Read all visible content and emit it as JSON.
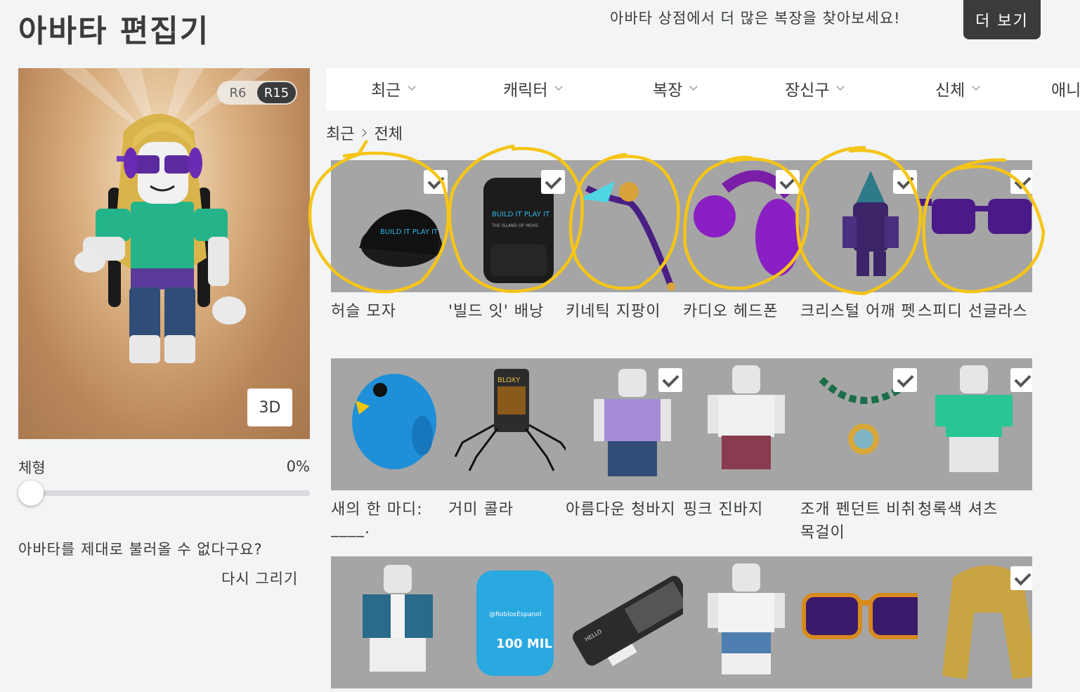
{
  "header": {
    "title": "아바타 편집기",
    "promo_text": "아바타 상점에서 더 많은 복장을 찾아보세요!",
    "more_button": "더 보기"
  },
  "avatar_panel": {
    "rig_options": [
      "R6",
      "R15"
    ],
    "rig_selected": "R15",
    "view_3d": "3D"
  },
  "body_type": {
    "label": "체형",
    "value": "0%",
    "level": 0
  },
  "help": {
    "question": "아바타를 제대로 불러올 수 없다구요?",
    "redraw": "다시 그리기"
  },
  "nav": {
    "tabs": [
      "최근",
      "캐릭터",
      "복장",
      "장신구",
      "신체",
      "애니"
    ]
  },
  "breadcrumb": {
    "root": "최근",
    "current": "전체"
  },
  "items": [
    {
      "name": "허슬 모자",
      "icon": "cap-icon",
      "checked": true
    },
    {
      "name": "'빌드 잇' 배낭",
      "icon": "backpack-icon",
      "checked": true
    },
    {
      "name": "키네틱 지팡이",
      "icon": "staff-icon",
      "checked": false
    },
    {
      "name": "카디오 헤드폰",
      "icon": "headphones-icon",
      "checked": true
    },
    {
      "name": "크리스털 어깨 펫",
      "icon": "shoulder-pet-icon",
      "checked": true
    },
    {
      "name": "스피디 선글라스",
      "icon": "sunglasses-icon",
      "checked": true
    },
    {
      "name": "새의 한 마디:",
      "name2": "____.",
      "icon": "bird-icon",
      "checked": false
    },
    {
      "name": "거미 콜라",
      "icon": "spider-cola-icon",
      "checked": false
    },
    {
      "name": "아름다운 청바지",
      "icon": "jeans-avatar-icon",
      "checked": true
    },
    {
      "name": "핑크 진바지",
      "icon": "pink-pants-avatar-icon",
      "checked": false
    },
    {
      "name": "조개 펜던트 비취",
      "name2": "목걸이",
      "icon": "necklace-icon",
      "checked": true
    },
    {
      "name": "청록색 셔츠",
      "icon": "teal-shirt-avatar-icon",
      "checked": true
    },
    {
      "name": "",
      "icon": "denim-jacket-avatar-icon",
      "checked": false
    },
    {
      "name": "",
      "icon": "blue-backpack-icon",
      "checked": false
    },
    {
      "name": "",
      "icon": "keytar-icon",
      "checked": false
    },
    {
      "name": "",
      "icon": "shorts-avatar-icon",
      "checked": false
    },
    {
      "name": "",
      "icon": "orange-sunglasses-icon",
      "checked": false
    },
    {
      "name": "",
      "icon": "blonde-hair-icon",
      "checked": true
    }
  ],
  "backpack_text": {
    "brand": "BUILD IT PLAY IT",
    "sub": "THE ISLAND OF MOVE"
  },
  "blue_backpack_text": {
    "handle": "@RobloxEspanol",
    "badge": "100 MIL"
  },
  "keytar_text": {
    "screen": "HELLO"
  },
  "cola_text": {
    "label": "BLOXY"
  },
  "colors": {
    "accent_dark": "#393b3d",
    "tile_bg": "#a5a5a5",
    "annotation": "#f5c518"
  }
}
